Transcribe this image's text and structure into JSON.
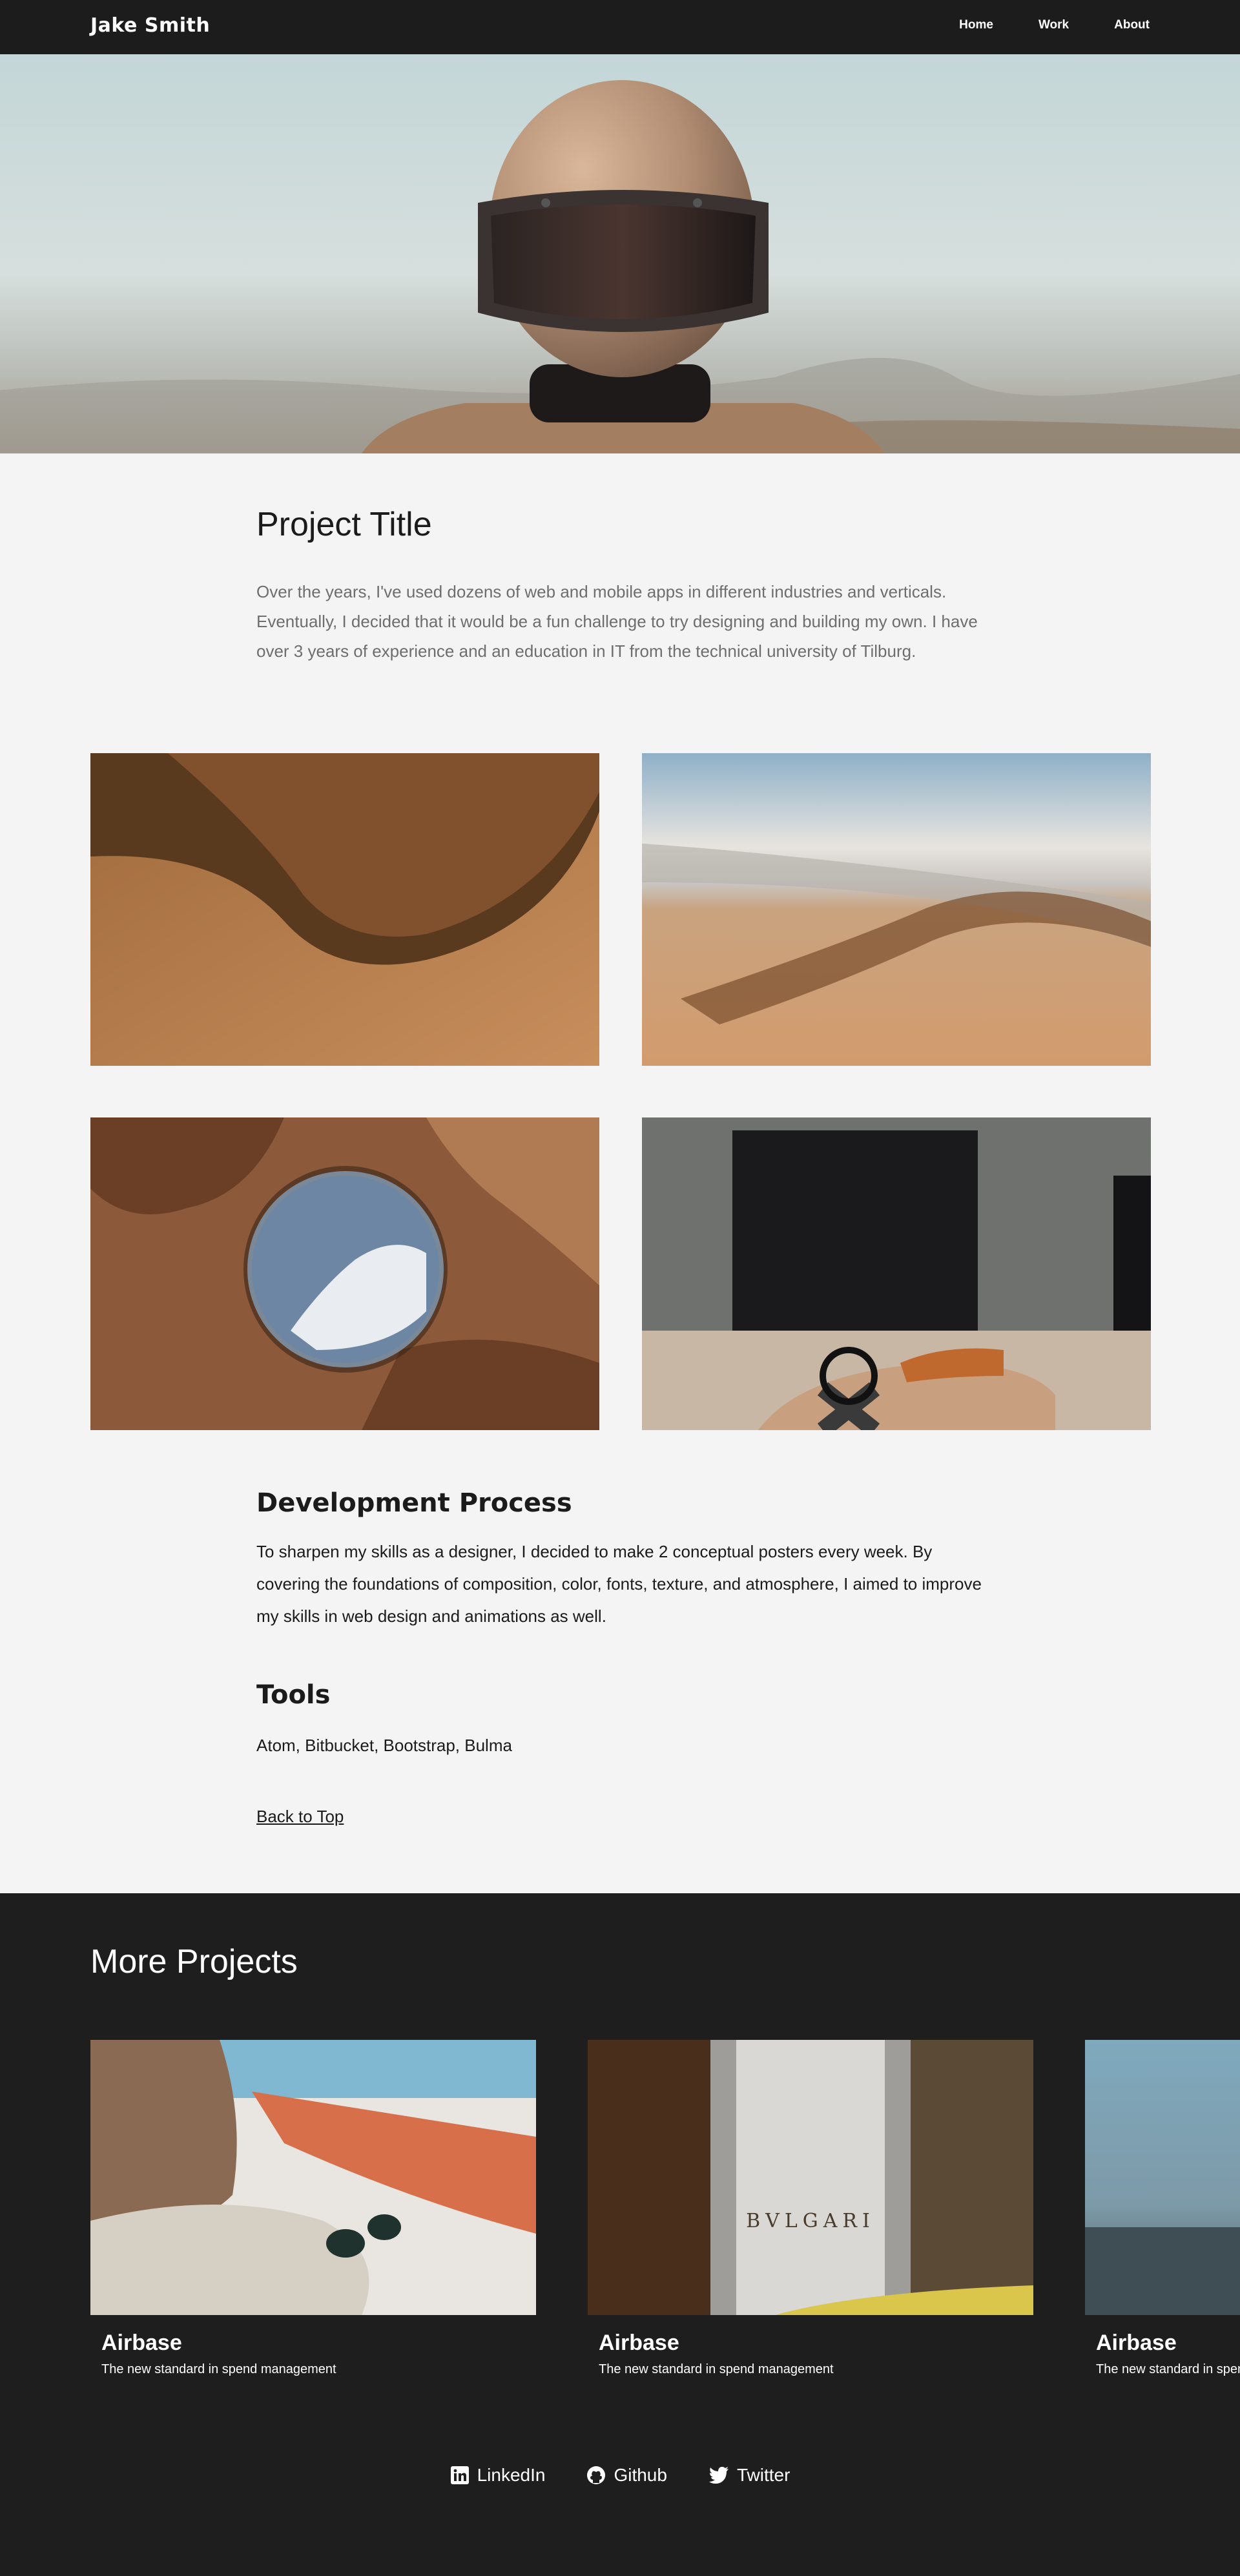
{
  "nav": {
    "brand": "Jake Smith",
    "links": [
      {
        "label": "Home"
      },
      {
        "label": "Work"
      },
      {
        "label": "About"
      }
    ]
  },
  "project": {
    "title": "Project Title",
    "description": "Over the years, I've used dozens of web and mobile apps in different industries and verticals. Eventually, I decided that it would be a fun challenge to try designing and building my own. I have over 3 years of experience and an education in IT from the technical university of Tilburg."
  },
  "development": {
    "heading": "Development Process",
    "text": "To sharpen my skills as a designer, I decided to make 2 conceptual posters every week. By covering the foundations of composition, color, fonts, texture, and atmosphere, I aimed to improve my skills in web design and animations as well."
  },
  "tools": {
    "heading": "Tools",
    "text": "Atom, Bitbucket, Bootstrap, Bulma"
  },
  "back_to_top": "Back to Top",
  "more": {
    "heading": "More Projects",
    "cards": [
      {
        "title": "Airbase",
        "subtitle": "The new standard in spend management"
      },
      {
        "title": "Airbase",
        "subtitle": "The new standard in spend management"
      },
      {
        "title": "Airbase",
        "subtitle": "The new standard in spend management"
      }
    ],
    "brand_sign": "BVLGARI"
  },
  "socials": [
    {
      "label": "LinkedIn",
      "icon": "linkedin-icon"
    },
    {
      "label": "Github",
      "icon": "github-icon"
    },
    {
      "label": "Twitter",
      "icon": "twitter-icon"
    }
  ]
}
